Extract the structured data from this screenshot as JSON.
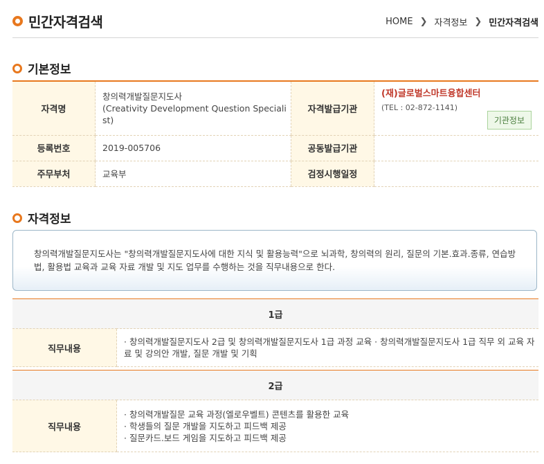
{
  "header": {
    "title": "민간자격검색",
    "breadcrumb": [
      "HOME",
      "자격정보",
      "민간자격검색"
    ]
  },
  "basic_info": {
    "section_title": "기본정보",
    "name_label": "자격명",
    "name_value": "창의력개발질문지도사\n(Creativity Development Question Specialist)",
    "issuer_label": "자격발급기관",
    "issuer_name": "(재)글로벌스마트융합센터",
    "issuer_tel": "(TEL : 02-872-1141)",
    "issuer_button": "기관정보",
    "reg_label": "등록번호",
    "reg_value": "2019-005706",
    "co_issuer_label": "공동발급기관",
    "co_issuer_value": "",
    "ministry_label": "주무부처",
    "ministry_value": "교육부",
    "exam_label": "검정시행일정",
    "exam_value": ""
  },
  "qual_info": {
    "section_title": "자격정보",
    "summary": "창의력개발질문지도사는 \"창의력개발질문지도사에 대한 지식 및 활용능력\"으로 뇌과학, 창의력의 원리, 질문의 기본.효과.종류, 연습방법, 활용법 교육과 교육 자료 개발 및 지도 업무를 수행하는 것을 직무내용으로 한다.",
    "grades": [
      {
        "name": "1급",
        "duty_label": "직무내용",
        "duties": [
          "· 창의력개발질문지도사 2급 및 창의력개발질문지도사 1급 과정 교육 · 창의력개발질문지도사 1급 직무 외 교육 자료 및 강의안 개발, 질문 개발 및 기획"
        ]
      },
      {
        "name": "2급",
        "duty_label": "직무내용",
        "duties": [
          "· 창의력개발질문 교육 과정(엘로우벨트) 콘텐츠를 활용한 교육",
          "· 학생들의 질문 개발을 지도하고 피드백 제공",
          "· 질문카드.보드 게임을 지도하고 피드백 제공"
        ]
      }
    ]
  },
  "colors": {
    "accent": "#e8781e",
    "label_bg": "#fff8e6",
    "issuer_name": "#c0392b"
  },
  "icons": {
    "section_bullet": "circle-bullet-icon",
    "breadcrumb_sep": "chevron-right-icon"
  }
}
